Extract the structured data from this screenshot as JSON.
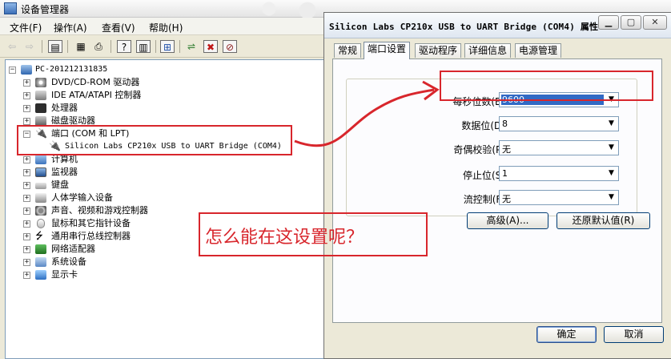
{
  "device_manager": {
    "title": "设备管理器",
    "menu": [
      "文件(F)",
      "操作(A)",
      "查看(V)",
      "帮助(H)"
    ],
    "toolbar_icons": [
      "back-arrow-icon",
      "forward-arrow-icon",
      "console-tree-icon",
      "properties-icon",
      "print-icon",
      "help-icon",
      "view-icon",
      "scan-hardware-icon",
      "update-driver-icon",
      "uninstall-icon",
      "disable-icon"
    ],
    "tree": {
      "root": "PC-201212131835",
      "items": [
        {
          "label": "DVD/CD-ROM 驱动器",
          "expanded": false
        },
        {
          "label": "IDE ATA/ATAPI 控制器",
          "expanded": false
        },
        {
          "label": "处理器",
          "expanded": false
        },
        {
          "label": "磁盘驱动器",
          "expanded": false
        },
        {
          "label": "端口 (COM 和 LPT)",
          "expanded": true
        },
        {
          "label": "Silicon Labs CP210x USB to UART Bridge (COM4)",
          "child": true
        },
        {
          "label": "计算机",
          "expanded": false
        },
        {
          "label": "监视器",
          "expanded": false
        },
        {
          "label": "键盘",
          "expanded": false
        },
        {
          "label": "人体学输入设备",
          "expanded": false
        },
        {
          "label": "声音、视频和游戏控制器",
          "expanded": false
        },
        {
          "label": "鼠标和其它指针设备",
          "expanded": false
        },
        {
          "label": "通用串行总线控制器",
          "expanded": false
        },
        {
          "label": "网络适配器",
          "expanded": false
        },
        {
          "label": "系统设备",
          "expanded": false
        },
        {
          "label": "显示卡",
          "expanded": false
        }
      ]
    }
  },
  "dialog": {
    "title": "Silicon Labs CP210x USB to UART Bridge (COM4) 属性",
    "caption_buttons": [
      "minimize-icon",
      "maximize-icon",
      "close-icon"
    ],
    "tabs": [
      {
        "label": "常规",
        "active": false
      },
      {
        "label": "端口设置",
        "active": true
      },
      {
        "label": "驱动程序",
        "active": false
      },
      {
        "label": "详细信息",
        "active": false
      },
      {
        "label": "电源管理",
        "active": false
      }
    ],
    "fields": [
      {
        "label": "每秒位数(B):",
        "value": "9600",
        "selected": true
      },
      {
        "label": "数据位(D):",
        "value": "8"
      },
      {
        "label": "奇偶校验(P):",
        "value": "无"
      },
      {
        "label": "停止位(S):",
        "value": "1"
      },
      {
        "label": "流控制(F):",
        "value": "无"
      }
    ],
    "advanced_button": "高级(A)...",
    "restore_button": "还原默认值(R)",
    "ok_button": "确定",
    "cancel_button": "取消"
  },
  "annotation": {
    "text": "怎么能在这设置呢？",
    "color": "#d8262c"
  }
}
